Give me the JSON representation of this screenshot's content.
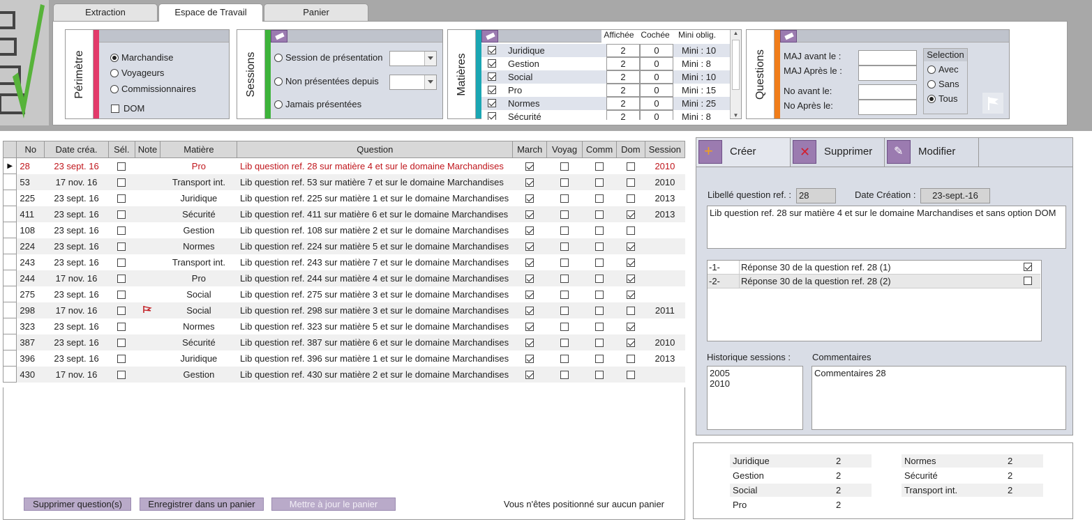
{
  "tabs": [
    "Extraction",
    "Espace de Travail",
    "Panier"
  ],
  "perimetre": {
    "title": "Périmètre",
    "options": [
      {
        "label": "Marchandise",
        "selected": true
      },
      {
        "label": "Voyageurs",
        "selected": false
      },
      {
        "label": "Commissionnaires",
        "selected": false
      }
    ],
    "dom_label": "DOM"
  },
  "sessions": {
    "title": "Sessions",
    "options": [
      "Session de présentation",
      "Non présentées depuis",
      "Jamais présentées"
    ]
  },
  "matieres": {
    "title": "Matières",
    "headers": [
      "Affichée",
      "Cochée",
      "Mini oblig."
    ],
    "rows": [
      {
        "name": "Juridique",
        "affichee": "2",
        "cochee": "0",
        "mini": "Mini : 10"
      },
      {
        "name": "Gestion",
        "affichee": "2",
        "cochee": "0",
        "mini": "Mini : 8"
      },
      {
        "name": "Social",
        "affichee": "2",
        "cochee": "0",
        "mini": "Mini : 10"
      },
      {
        "name": "Pro",
        "affichee": "2",
        "cochee": "0",
        "mini": "Mini : 15"
      },
      {
        "name": "Normes",
        "affichee": "2",
        "cochee": "0",
        "mini": "Mini : 25"
      },
      {
        "name": "Sécurité",
        "affichee": "2",
        "cochee": "0",
        "mini": "Mini : 8"
      }
    ]
  },
  "questions": {
    "title": "Questions",
    "labels": [
      "MAJ avant le :",
      "MAJ Après le :",
      "No avant le:",
      "No Après le:"
    ],
    "selection_title": "Selection",
    "selection": [
      {
        "label": "Avec",
        "selected": false
      },
      {
        "label": "Sans",
        "selected": false
      },
      {
        "label": "Tous",
        "selected": true
      }
    ]
  },
  "grid": {
    "headers": [
      "No",
      "Date créa.",
      "Sél.",
      "Note",
      "Matière",
      "Question",
      "March",
      "Voyag",
      "Comm",
      "Dom",
      "Session"
    ],
    "rows": [
      {
        "no": "28",
        "date": "23 sept. 16",
        "matiere": "Pro",
        "question": "Lib question ref. 28 sur matière 4 et sur le domaine Marchandises",
        "march": true,
        "dom": false,
        "session": "2010",
        "flag": false
      },
      {
        "no": "53",
        "date": "17 nov. 16",
        "matiere": "Transport int.",
        "question": "Lib question ref. 53 sur matière 7 et sur le domaine Marchandises",
        "march": true,
        "dom": false,
        "session": "2010",
        "flag": false
      },
      {
        "no": "225",
        "date": "23 sept. 16",
        "matiere": "Juridique",
        "question": "Lib question ref. 225 sur matière 1 et sur le domaine Marchandises",
        "march": true,
        "dom": false,
        "session": "2013",
        "flag": false
      },
      {
        "no": "411",
        "date": "23 sept. 16",
        "matiere": "Sécurité",
        "question": "Lib question ref. 411 sur matière 6 et sur le domaine Marchandises",
        "march": true,
        "dom": true,
        "session": "2013",
        "flag": false
      },
      {
        "no": "108",
        "date": "23 sept. 16",
        "matiere": "Gestion",
        "question": "Lib question ref. 108 sur matière 2 et sur le domaine Marchandises",
        "march": true,
        "dom": false,
        "session": "",
        "flag": false
      },
      {
        "no": "224",
        "date": "23 sept. 16",
        "matiere": "Normes",
        "question": "Lib question ref. 224 sur matière 5 et sur le domaine Marchandises",
        "march": true,
        "dom": true,
        "session": "",
        "flag": false
      },
      {
        "no": "243",
        "date": "23 sept. 16",
        "matiere": "Transport int.",
        "question": "Lib question ref. 243 sur matière 7 et sur le domaine Marchandises",
        "march": true,
        "dom": true,
        "session": "",
        "flag": false
      },
      {
        "no": "244",
        "date": "17 nov. 16",
        "matiere": "Pro",
        "question": "Lib question ref. 244 sur matière 4 et sur le domaine Marchandises",
        "march": true,
        "dom": true,
        "session": "",
        "flag": false
      },
      {
        "no": "275",
        "date": "23 sept. 16",
        "matiere": "Social",
        "question": "Lib question ref. 275 sur matière 3 et sur le domaine Marchandises",
        "march": true,
        "dom": true,
        "session": "",
        "flag": false
      },
      {
        "no": "298",
        "date": "17 nov. 16",
        "matiere": "Social",
        "question": "Lib question ref. 298 sur matière 3 et sur le domaine Marchandises",
        "march": true,
        "dom": false,
        "session": "2011",
        "flag": true
      },
      {
        "no": "323",
        "date": "23 sept. 16",
        "matiere": "Normes",
        "question": "Lib question ref. 323 sur matière 5 et sur le domaine Marchandises",
        "march": true,
        "dom": true,
        "session": "",
        "flag": false
      },
      {
        "no": "387",
        "date": "23 sept. 16",
        "matiere": "Sécurité",
        "question": "Lib question ref. 387 sur matière 6 et sur le domaine Marchandises",
        "march": true,
        "dom": true,
        "session": "2010",
        "flag": false
      },
      {
        "no": "396",
        "date": "23 sept. 16",
        "matiere": "Juridique",
        "question": "Lib question ref. 396 sur matière 1 et sur le domaine Marchandises",
        "march": true,
        "dom": false,
        "session": "2013",
        "flag": false
      },
      {
        "no": "430",
        "date": "17 nov. 16",
        "matiere": "Gestion",
        "question": "Lib question ref. 430 sur matière 2 et sur le domaine Marchandises",
        "march": true,
        "dom": false,
        "session": "",
        "flag": false
      }
    ]
  },
  "buttons": {
    "delete": "Supprimer question(s)",
    "save_basket": "Enregistrer dans un panier",
    "update_basket": "Mettre à jour le panier"
  },
  "status": "Vous n'êtes positionné sur aucun panier",
  "detail": {
    "tabs": [
      "Créer",
      "Supprimer",
      "Modifier"
    ],
    "libelle_label": "Libellé question ref. :",
    "libelle_value": "28",
    "date_label": "Date Création :",
    "date_value": "23-sept.-16",
    "question_text": "Lib question ref. 28 sur matière 4 et sur le domaine Marchandises et sans option DOM",
    "answers": [
      {
        "num": "-1-",
        "text": "Réponse 30 de la question ref. 28 (1)",
        "checked": true
      },
      {
        "num": "-2-",
        "text": "Réponse 30 de la question ref. 28 (2)",
        "checked": false
      }
    ],
    "historique_label": "Historique sessions :",
    "historique": [
      "2005",
      "2010"
    ],
    "commentaires_label": "Commentaires",
    "commentaires": "Commentaires 28"
  },
  "summary": [
    {
      "name": "Juridique",
      "count": "2"
    },
    {
      "name": "Gestion",
      "count": "2"
    },
    {
      "name": "Social",
      "count": "2"
    },
    {
      "name": "Pro",
      "count": "2"
    },
    {
      "name": "Normes",
      "count": "2"
    },
    {
      "name": "Sécurité",
      "count": "2"
    },
    {
      "name": "Transport int.",
      "count": "2"
    }
  ]
}
